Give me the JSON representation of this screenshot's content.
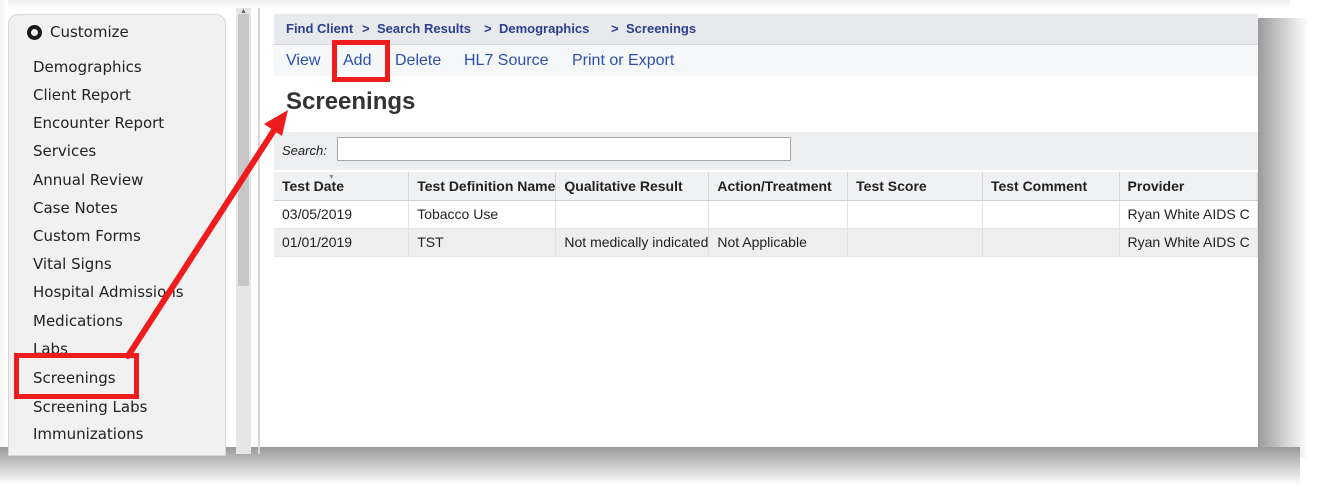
{
  "colors": {
    "annotation": "#ee1c1c",
    "link": "#2b4fb5",
    "breadcrumb": "#2b3f8e"
  },
  "sidebar": {
    "customize_label": "Customize",
    "items": [
      {
        "label": "Demographics"
      },
      {
        "label": "Client Report"
      },
      {
        "label": "Encounter Report"
      },
      {
        "label": "Services"
      },
      {
        "label": "Annual Review"
      },
      {
        "label": "Case Notes"
      },
      {
        "label": "Custom Forms"
      },
      {
        "label": "Vital Signs"
      },
      {
        "label": "Hospital Admissions"
      },
      {
        "label": "Medications"
      },
      {
        "label": "Labs"
      },
      {
        "label": "Screenings"
      },
      {
        "label": "Screening Labs"
      },
      {
        "label": "Immunizations"
      }
    ]
  },
  "breadcrumb": {
    "items": [
      "Find Client",
      "Search Results",
      "Demographics",
      "Screenings"
    ],
    "separator": ">"
  },
  "actions": {
    "view": "View",
    "add": "Add",
    "delete": "Delete",
    "hl7_source": "HL7 Source",
    "print_export": "Print or Export"
  },
  "page_title": "Screenings",
  "search": {
    "label": "Search:",
    "value": ""
  },
  "table": {
    "columns": [
      "Test Date",
      "Test Definition Name",
      "Qualitative Result",
      "Action/Treatment",
      "Test Score",
      "Test Comment",
      "Provider"
    ],
    "rows": [
      [
        "03/05/2019",
        "Tobacco Use",
        "",
        "",
        "",
        "",
        "Ryan White AIDS C"
      ],
      [
        "01/01/2019",
        "TST",
        "Not medically indicated",
        "Not Applicable",
        "",
        "",
        "Ryan White AIDS C"
      ]
    ]
  }
}
